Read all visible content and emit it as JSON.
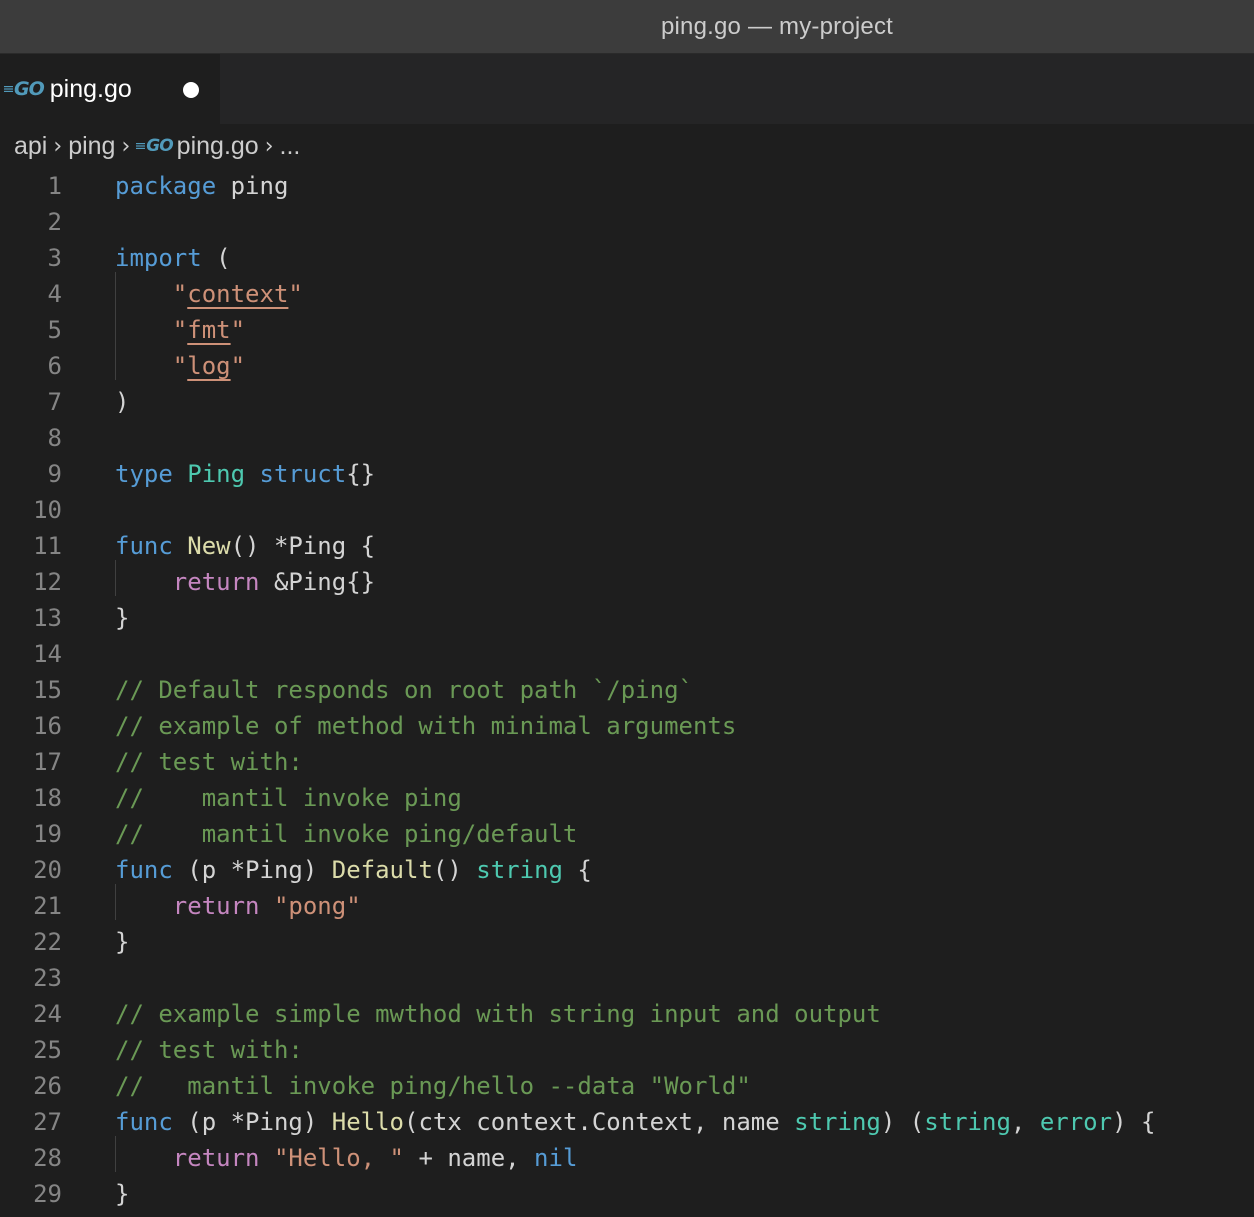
{
  "window": {
    "title": "ping.go — my-project"
  },
  "tabs": [
    {
      "label": "ping.go",
      "icon": "go-file-icon",
      "dirty": true
    }
  ],
  "breadcrumb": {
    "items": [
      "api",
      "ping",
      "ping.go",
      "..."
    ]
  },
  "editor": {
    "lines": [
      {
        "n": "1",
        "t": [
          [
            "kw",
            "package"
          ],
          [
            "id",
            " ping"
          ]
        ]
      },
      {
        "n": "2",
        "t": []
      },
      {
        "n": "3",
        "t": [
          [
            "kw",
            "import"
          ],
          [
            "id",
            " ("
          ]
        ]
      },
      {
        "n": "4",
        "t": [
          [
            "id",
            "    "
          ],
          [
            "str",
            "\""
          ],
          [
            "strul",
            "context"
          ],
          [
            "str",
            "\""
          ]
        ]
      },
      {
        "n": "5",
        "t": [
          [
            "id",
            "    "
          ],
          [
            "str",
            "\""
          ],
          [
            "strul",
            "fmt"
          ],
          [
            "str",
            "\""
          ]
        ]
      },
      {
        "n": "6",
        "t": [
          [
            "id",
            "    "
          ],
          [
            "str",
            "\""
          ],
          [
            "strul",
            "log"
          ],
          [
            "str",
            "\""
          ]
        ]
      },
      {
        "n": "7",
        "t": [
          [
            "id",
            ")"
          ]
        ]
      },
      {
        "n": "8",
        "t": []
      },
      {
        "n": "9",
        "t": [
          [
            "kw",
            "type"
          ],
          [
            "id",
            " "
          ],
          [
            "ty",
            "Ping"
          ],
          [
            "id",
            " "
          ],
          [
            "kw",
            "struct"
          ],
          [
            "id",
            "{}"
          ]
        ]
      },
      {
        "n": "10",
        "t": []
      },
      {
        "n": "11",
        "t": [
          [
            "kw",
            "func"
          ],
          [
            "id",
            " "
          ],
          [
            "fn",
            "New"
          ],
          [
            "id",
            "() *Ping {"
          ]
        ]
      },
      {
        "n": "12",
        "t": [
          [
            "id",
            "    "
          ],
          [
            "kc",
            "return"
          ],
          [
            "id",
            " &Ping{}"
          ]
        ]
      },
      {
        "n": "13",
        "t": [
          [
            "id",
            "}"
          ]
        ]
      },
      {
        "n": "14",
        "t": []
      },
      {
        "n": "15",
        "t": [
          [
            "cm",
            "// Default responds on root path `/ping`"
          ]
        ]
      },
      {
        "n": "16",
        "t": [
          [
            "cm",
            "// example of method with minimal arguments"
          ]
        ]
      },
      {
        "n": "17",
        "t": [
          [
            "cm",
            "// test with:"
          ]
        ]
      },
      {
        "n": "18",
        "t": [
          [
            "cm",
            "//    mantil invoke ping"
          ]
        ]
      },
      {
        "n": "19",
        "t": [
          [
            "cm",
            "//    mantil invoke ping/default"
          ]
        ]
      },
      {
        "n": "20",
        "t": [
          [
            "kw",
            "func"
          ],
          [
            "id",
            " (p *Ping) "
          ],
          [
            "fn",
            "Default"
          ],
          [
            "id",
            "() "
          ],
          [
            "ty",
            "string"
          ],
          [
            "id",
            " {"
          ]
        ]
      },
      {
        "n": "21",
        "t": [
          [
            "id",
            "    "
          ],
          [
            "kc",
            "return"
          ],
          [
            "id",
            " "
          ],
          [
            "str",
            "\"pong\""
          ]
        ]
      },
      {
        "n": "22",
        "t": [
          [
            "id",
            "}"
          ]
        ]
      },
      {
        "n": "23",
        "t": []
      },
      {
        "n": "24",
        "t": [
          [
            "cm",
            "// example simple mwthod with string input and output"
          ]
        ]
      },
      {
        "n": "25",
        "t": [
          [
            "cm",
            "// test with:"
          ]
        ]
      },
      {
        "n": "26",
        "t": [
          [
            "cm",
            "//   mantil invoke ping/hello --data \"World\""
          ]
        ]
      },
      {
        "n": "27",
        "t": [
          [
            "kw",
            "func"
          ],
          [
            "id",
            " (p *Ping) "
          ],
          [
            "fn",
            "Hello"
          ],
          [
            "id",
            "(ctx context.Context, name "
          ],
          [
            "ty",
            "string"
          ],
          [
            "id",
            ") ("
          ],
          [
            "ty",
            "string"
          ],
          [
            "id",
            ", "
          ],
          [
            "ty",
            "error"
          ],
          [
            "id",
            ") {"
          ]
        ]
      },
      {
        "n": "28",
        "t": [
          [
            "id",
            "    "
          ],
          [
            "kc",
            "return"
          ],
          [
            "id",
            " "
          ],
          [
            "str",
            "\"Hello, \""
          ],
          [
            "id",
            " + name, "
          ],
          [
            "kw",
            "nil"
          ]
        ]
      },
      {
        "n": "29",
        "t": [
          [
            "id",
            "}"
          ]
        ]
      }
    ]
  }
}
